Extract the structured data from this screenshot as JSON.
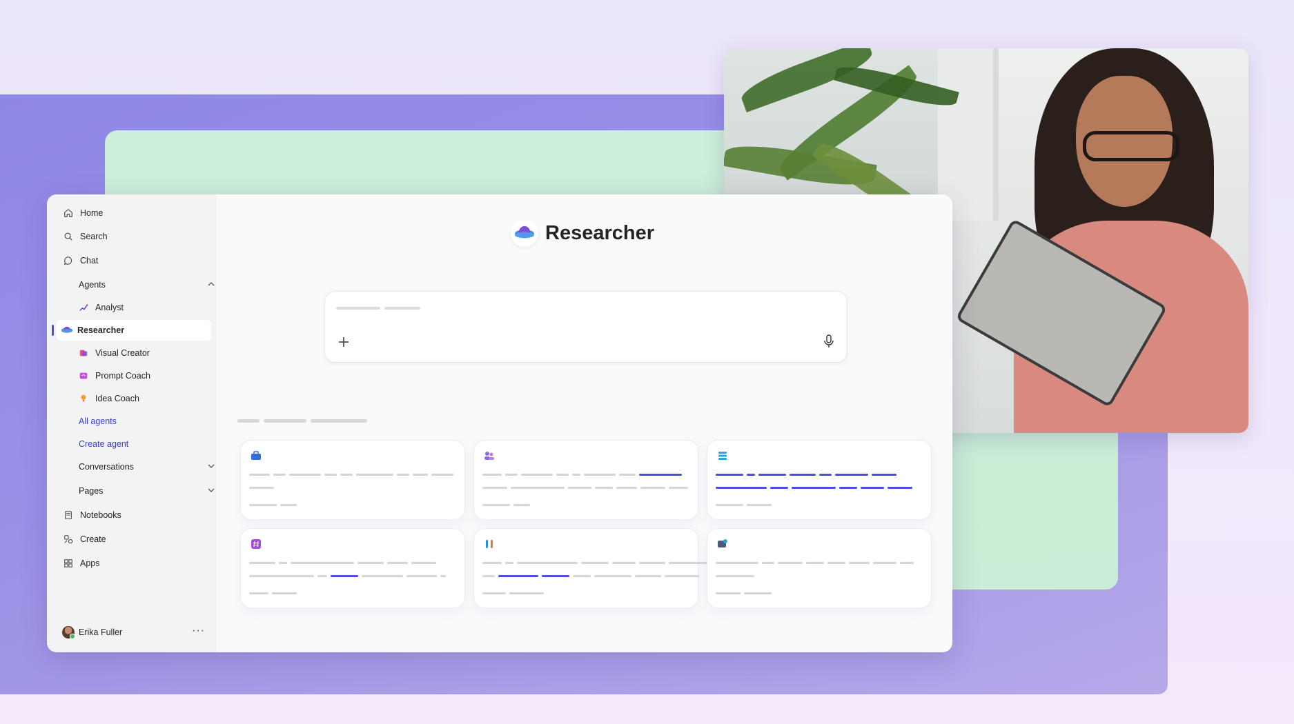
{
  "sidebar": {
    "items": [
      {
        "label": "Home",
        "icon": "home-icon"
      },
      {
        "label": "Search",
        "icon": "search-icon"
      },
      {
        "label": "Chat",
        "icon": "chat-icon"
      }
    ],
    "agents_label": "Agents",
    "agents": [
      {
        "label": "Analyst",
        "icon": "analyst-icon"
      },
      {
        "label": "Researcher",
        "icon": "researcher-icon",
        "selected": true
      },
      {
        "label": "Visual Creator",
        "icon": "visual-creator-icon"
      },
      {
        "label": "Prompt Coach",
        "icon": "prompt-coach-icon"
      },
      {
        "label": "Idea Coach",
        "icon": "idea-coach-icon"
      }
    ],
    "all_agents": "All agents",
    "create_agent": "Create agent",
    "conversations": "Conversations",
    "pages": "Pages",
    "notebooks": "Notebooks",
    "create": "Create",
    "apps": "Apps",
    "user_name": "Erika Fuller",
    "more_label": "···"
  },
  "main": {
    "title": "Researcher",
    "composer": {
      "add_icon": "plus-icon",
      "mic_icon": "microphone-icon"
    }
  },
  "colors": {
    "accent": "#4b4bdc",
    "background_purple": "#8f87e6",
    "background_green": "#cdeed8"
  }
}
